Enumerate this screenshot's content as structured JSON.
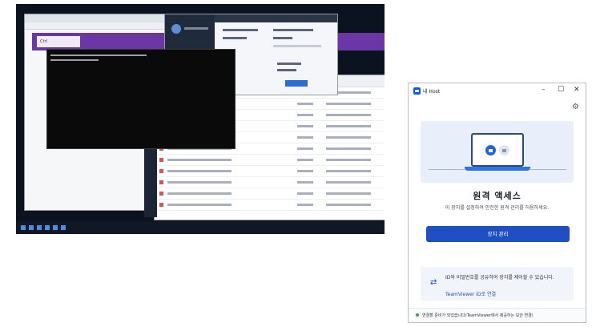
{
  "remote": {
    "purple_tab_label": "Ctrl"
  },
  "teamviewer": {
    "window_title": "내 Host",
    "controls": {
      "minimize": "–",
      "maximize": "☐",
      "close": "✕"
    },
    "settings_icon": "gear-icon",
    "heading": "원격 액세스",
    "description": "이 장치를 설정하여 안전한 원격 관리를 허용하세요.",
    "primary_button": "장치 관리",
    "id_card": {
      "text": "ID와 비밀번호를 공유하여 장치를 제어할 수 있습니다.",
      "link": "TeamViewer ID로 연결",
      "icon": "swap-arrows-icon"
    },
    "status": {
      "text": "연결할 준비가 되었습니다(TeamViewer에서 제공하는 보안 연결)",
      "color": "#2faa4a"
    },
    "accent_color": "#1f4fc2"
  }
}
